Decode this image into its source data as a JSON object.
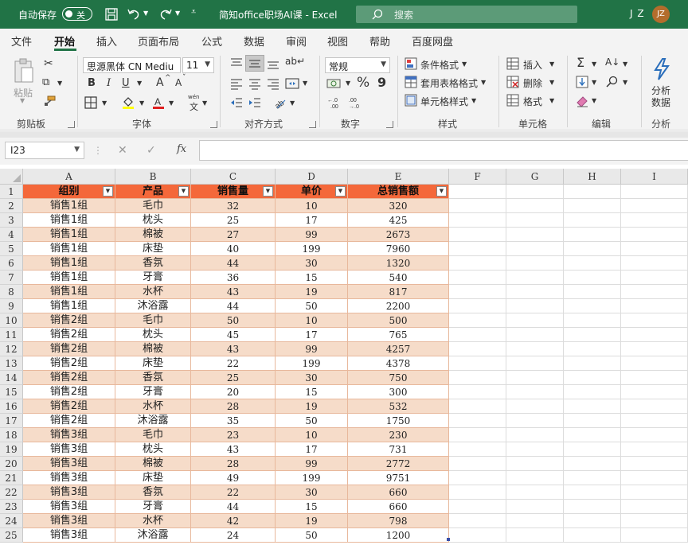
{
  "titlebar": {
    "autosave_label": "自动保存",
    "autosave_state": "关",
    "title": "简知office职场AI课  -  Excel",
    "search_placeholder": "搜索",
    "user_initials": "J Z",
    "avatar_text": "JZ"
  },
  "ribbon_tabs": [
    "文件",
    "开始",
    "插入",
    "页面布局",
    "公式",
    "数据",
    "审阅",
    "视图",
    "帮助",
    "百度网盘"
  ],
  "active_tab": "开始",
  "ribbon": {
    "clipboard": {
      "label": "剪贴板",
      "paste": "粘贴"
    },
    "font": {
      "label": "字体",
      "font_name": "思源黑体 CN Mediu",
      "font_size": "11",
      "bold": "B",
      "italic": "I",
      "underline": "U",
      "grow": "A",
      "shrink": "A",
      "wen": "wén",
      "wen_char": "文"
    },
    "alignment": {
      "label": "对齐方式"
    },
    "number": {
      "label": "数字",
      "format": "常规",
      "percent": "%",
      "comma": "9"
    },
    "styles": {
      "label": "样式",
      "conditional": "条件格式",
      "table_format": "套用表格格式",
      "cell_styles": "单元格样式"
    },
    "cells": {
      "label": "单元格",
      "insert": "插入",
      "delete": "删除",
      "format": "格式"
    },
    "editing": {
      "label": "编辑"
    },
    "analysis": {
      "label": "分析",
      "analyze_line1": "分析",
      "analyze_line2": "数据"
    }
  },
  "formula_bar": {
    "name_box": "I23",
    "fx": "fx",
    "content": ""
  },
  "columns": [
    "A",
    "B",
    "C",
    "D",
    "E",
    "F",
    "G",
    "H",
    "I"
  ],
  "headers": [
    "组别",
    "产品",
    "销售量",
    "单价",
    "总销售额"
  ],
  "rows": [
    [
      "销售1组",
      "毛巾",
      "32",
      "10",
      "320"
    ],
    [
      "销售1组",
      "枕头",
      "25",
      "17",
      "425"
    ],
    [
      "销售1组",
      "棉被",
      "27",
      "99",
      "2673"
    ],
    [
      "销售1组",
      "床垫",
      "40",
      "199",
      "7960"
    ],
    [
      "销售1组",
      "香氛",
      "44",
      "30",
      "1320"
    ],
    [
      "销售1组",
      "牙膏",
      "36",
      "15",
      "540"
    ],
    [
      "销售1组",
      "水杯",
      "43",
      "19",
      "817"
    ],
    [
      "销售1组",
      "沐浴露",
      "44",
      "50",
      "2200"
    ],
    [
      "销售2组",
      "毛巾",
      "50",
      "10",
      "500"
    ],
    [
      "销售2组",
      "枕头",
      "45",
      "17",
      "765"
    ],
    [
      "销售2组",
      "棉被",
      "43",
      "99",
      "4257"
    ],
    [
      "销售2组",
      "床垫",
      "22",
      "199",
      "4378"
    ],
    [
      "销售2组",
      "香氛",
      "25",
      "30",
      "750"
    ],
    [
      "销售2组",
      "牙膏",
      "20",
      "15",
      "300"
    ],
    [
      "销售2组",
      "水杯",
      "28",
      "19",
      "532"
    ],
    [
      "销售2组",
      "沐浴露",
      "35",
      "50",
      "1750"
    ],
    [
      "销售3组",
      "毛巾",
      "23",
      "10",
      "230"
    ],
    [
      "销售3组",
      "枕头",
      "43",
      "17",
      "731"
    ],
    [
      "销售3组",
      "棉被",
      "28",
      "99",
      "2772"
    ],
    [
      "销售3组",
      "床垫",
      "49",
      "199",
      "9751"
    ],
    [
      "销售3组",
      "香氛",
      "22",
      "30",
      "660"
    ],
    [
      "销售3组",
      "牙膏",
      "44",
      "15",
      "660"
    ],
    [
      "销售3组",
      "水杯",
      "42",
      "19",
      "798"
    ],
    [
      "销售3组",
      "沐浴露",
      "24",
      "50",
      "1200"
    ]
  ],
  "row_numbers": [
    "1",
    "2",
    "3",
    "4",
    "5",
    "6",
    "7",
    "8",
    "9",
    "10",
    "11",
    "12",
    "13",
    "14",
    "15",
    "16",
    "17",
    "18",
    "19",
    "20",
    "21",
    "22",
    "23",
    "24",
    "25"
  ],
  "colors": {
    "titlebar": "#217346",
    "header_fill": "#f4683a",
    "band_fill": "#f6dcc9"
  }
}
